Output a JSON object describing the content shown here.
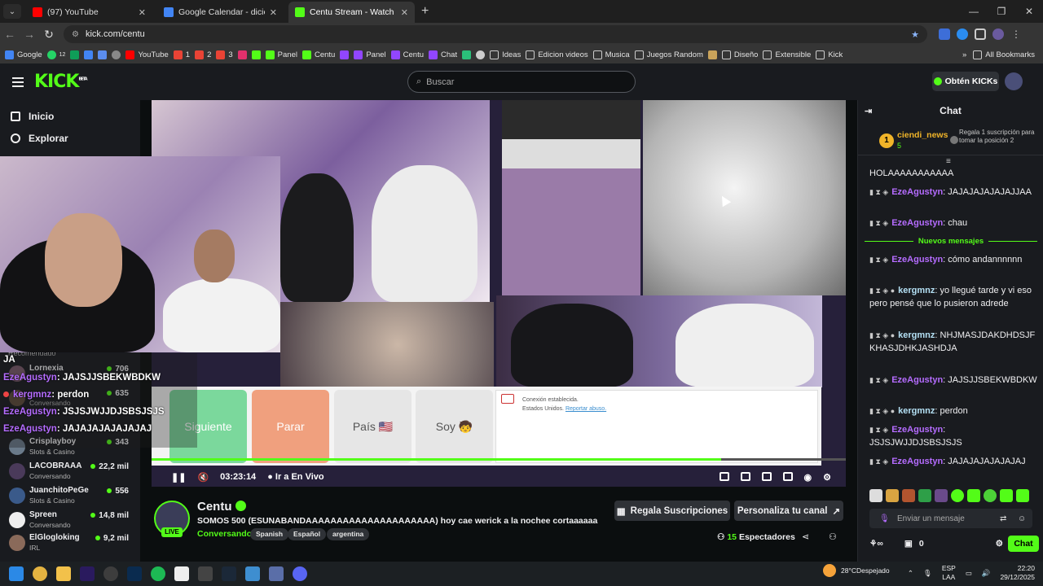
{
  "browser": {
    "tabs": [
      {
        "title": "(97) YouTube",
        "color": "#ff0000"
      },
      {
        "title": "Google Calendar - diciembre d",
        "color": "#4285f4"
      },
      {
        "title": "Centu Stream - Watch Live on K",
        "color": "#53fc18"
      }
    ],
    "url": "kick.com/centu",
    "bookmarks": [
      "Google",
      "12",
      "YouTube",
      "1",
      "2",
      "3",
      "Panel",
      "Centu",
      "Panel",
      "Centu",
      "Chat",
      "Ideas",
      "Edicion videos",
      "Musica",
      "Juegos Random",
      "Diseño",
      "Extensible",
      "Kick"
    ],
    "all_bookmarks": "All Bookmarks"
  },
  "header": {
    "logo": "KICK",
    "logo_badge": "BETA",
    "search_placeholder": "Buscar",
    "get_kicks": "Obtén KICKs"
  },
  "sidebar": {
    "nav": [
      {
        "label": "Inicio"
      },
      {
        "label": "Explorar"
      }
    ],
    "section": "Recomendado",
    "channels": [
      {
        "name": "Lornexia",
        "category": "",
        "viewers": "706"
      },
      {
        "name": "",
        "category": "Conversando",
        "viewers": "635"
      },
      {
        "name": "Crisplayboy",
        "category": "Slots & Casino",
        "viewers": "343"
      },
      {
        "name": "LACOBRAAA",
        "category": "Conversando",
        "viewers": "22,2 mil"
      },
      {
        "name": "JuanchitoPeGe",
        "category": "Slots & Casino",
        "viewers": "556"
      },
      {
        "name": "Spreen",
        "category": "Conversando",
        "viewers": "14,8 mil"
      },
      {
        "name": "ElGlogloking",
        "category": "IRL",
        "viewers": "9,2 mil"
      }
    ]
  },
  "video": {
    "omegle_buttons": [
      {
        "label": "Siguiente"
      },
      {
        "label": "Parar"
      },
      {
        "label": "País 🇺🇸"
      },
      {
        "label": "Soy 🧒"
      }
    ],
    "omegle_msg1": "Conexión establecida.",
    "omegle_msg2": "Estados Unidos.",
    "omegle_report": "Reportar abuso.",
    "progress": 0.82,
    "time": "03:23:14",
    "go_live": "Ir a En Vivo"
  },
  "overlay_chat": [
    {
      "user": "",
      "text": "JA"
    },
    {
      "user": "EzeAgustyn",
      "text": ": JAJSJJSBEKWBDKW"
    },
    {
      "user": "kergmnz",
      "text": ": perdon"
    },
    {
      "user": "EzeAgustyn",
      "text": ": JSJSJWJJDJSBSJSJS"
    },
    {
      "user": "EzeAgustyn",
      "text": ": JAJAJAJAJAJAJAJ"
    }
  ],
  "stream": {
    "name": "Centu",
    "live": "LIVE",
    "title": "SOMOS 500 (ESUNABANDAAAAAAAAAAAAAAAAAAAAA) hoy cae werick a la nochee cortaaaaaa",
    "category": "Conversando",
    "tags": [
      "Spanish",
      "Español",
      "argentina"
    ],
    "gift_subs": "Regala Suscripciones",
    "customize": "Personaliza tu canal",
    "viewer_count": "15",
    "viewer_label": "Espectadores"
  },
  "chat": {
    "title": "Chat",
    "pinned_user": "ciendi_news",
    "pinned_count": "5",
    "pinned_rank": "1",
    "pinned_text": "Regala 1 suscripción para tomar la posición 2",
    "new_messages": "Nuevos mensajes",
    "messages": [
      {
        "user": "",
        "text": "HOLAAAAAAAAAAA"
      },
      {
        "user": "EzeAgustyn",
        "text": ": JAJAJAJAJAJAJJAA"
      },
      {
        "user": "EzeAgustyn",
        "text": ": chau"
      },
      {
        "user": "EzeAgustyn",
        "text": ": cómo andannnnnn"
      },
      {
        "user": "kergmnz",
        "text": ": yo llegué tarde y vi eso pero pensé que lo pusieron adrede"
      },
      {
        "user": "kergmnz",
        "text": ": NHJMASJDAKDHDSJFKHASJDHKJASHDJA"
      },
      {
        "user": "EzeAgustyn",
        "text": ": JAJSJJSBEKWBDKW"
      },
      {
        "user": "kergmnz",
        "text": ": perdon"
      },
      {
        "user": "EzeAgustyn",
        "text": ": JSJSJWJJDJSBSJSJS"
      },
      {
        "user": "EzeAgustyn",
        "text": ": JAJAJAJAJAJAJAJ"
      }
    ],
    "input_placeholder": "Enviar un mensaje",
    "points": "0",
    "send": "Chat"
  },
  "taskbar": {
    "weather_temp": "28°C",
    "weather_desc": "Despejado",
    "lang1": "ESP",
    "lang2": "LAA",
    "time": "22:20",
    "date": "29/12/2025"
  },
  "colors": {
    "accent": "#53fc18",
    "chat_user": "#b56cff"
  }
}
